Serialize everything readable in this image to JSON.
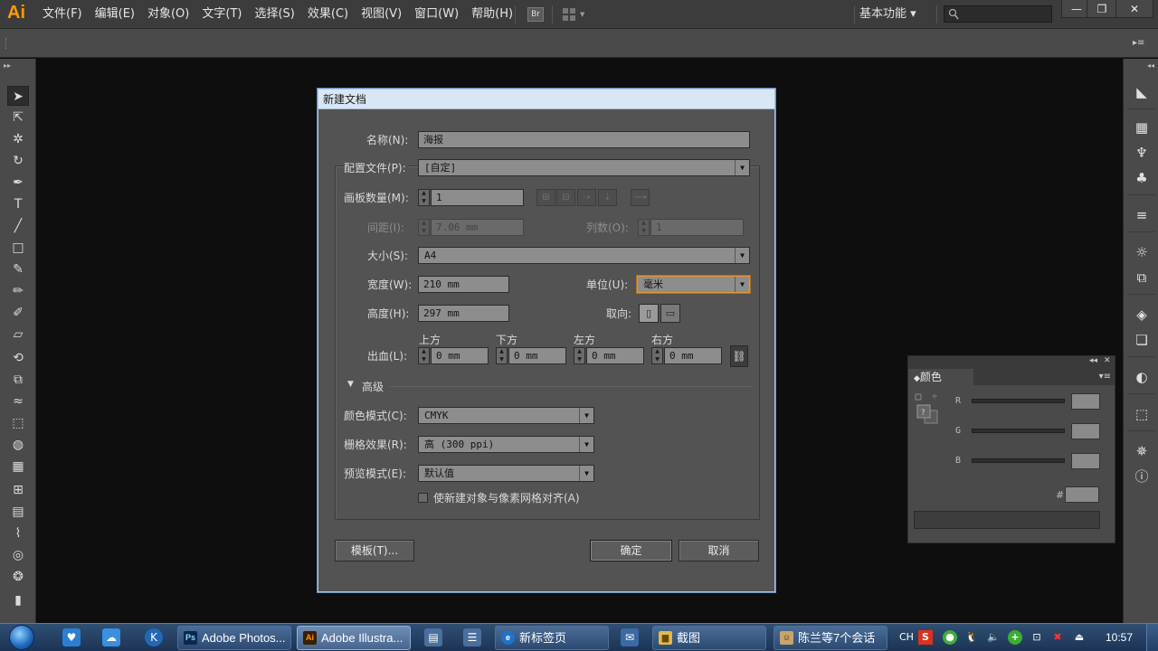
{
  "app": {
    "logo": "Ai"
  },
  "menus": [
    "文件(F)",
    "编辑(E)",
    "对象(O)",
    "文字(T)",
    "选择(S)",
    "效果(C)",
    "视图(V)",
    "窗口(W)",
    "帮助(H)"
  ],
  "menubar": {
    "bridge": "Br",
    "workspace": "基本功能 ▾",
    "search_placeholder": ""
  },
  "window_controls": {
    "minimize": "—",
    "restore": "❐",
    "close": "✕"
  },
  "dialog": {
    "title": "新建文档",
    "name_label": "名称(N):",
    "name_value": "海报",
    "profile_label": "配置文件(P):",
    "profile_value": "[自定]",
    "artboards_label": "画板数量(M):",
    "artboards_value": "1",
    "spacing_label": "间距(I):",
    "spacing_value": "7.06 mm",
    "columns_label": "列数(O):",
    "columns_value": "1",
    "size_label": "大小(S):",
    "size_value": "A4",
    "width_label": "宽度(W):",
    "width_value": "210 mm",
    "units_label": "单位(U):",
    "units_value": "毫米",
    "height_label": "高度(H):",
    "height_value": "297 mm",
    "orientation_label": "取向:",
    "bleed_label": "出血(L):",
    "bleed": [
      {
        "label": "上方",
        "value": "0 mm"
      },
      {
        "label": "下方",
        "value": "0 mm"
      },
      {
        "label": "左方",
        "value": "0 mm"
      },
      {
        "label": "右方",
        "value": "0 mm"
      }
    ],
    "advanced_label": "高级",
    "color_mode_label": "颜色模式(C):",
    "color_mode_value": "CMYK",
    "raster_label": "栅格效果(R):",
    "raster_value": "高 (300 ppi)",
    "preview_label": "预览模式(E):",
    "preview_value": "默认值",
    "align_pixel_label": "使新建对象与像素网格对齐(A)",
    "align_pixel_checked": false,
    "templates_button": "模板(T)...",
    "ok_button": "确定",
    "cancel_button": "取消"
  },
  "color_panel": {
    "title": "颜色",
    "channels": [
      "R",
      "G",
      "B"
    ],
    "hex_label": "#"
  },
  "taskbar": {
    "tasks": [
      {
        "label": "Adobe Photos...",
        "icon": "Ps"
      },
      {
        "label": "Adobe Illustra...",
        "icon": "Ai"
      },
      {
        "label": "新标签页",
        "icon": ""
      },
      {
        "label": "截图",
        "icon": ""
      },
      {
        "label": "陈兰等7个会话",
        "icon": ""
      }
    ],
    "ime": "CH",
    "clock": "10:57"
  }
}
